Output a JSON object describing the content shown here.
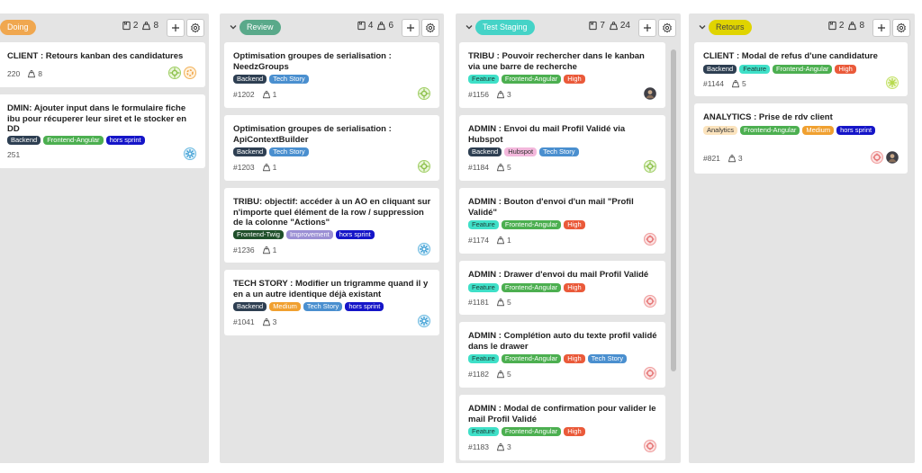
{
  "columns": [
    {
      "name": "Doing",
      "pill_bg": "#f0a74f",
      "pill_fg": "#ffffff",
      "count_tickets": "2",
      "count_points": "8"
    },
    {
      "name": "Review",
      "pill_bg": "#5aa98a",
      "pill_fg": "#ffffff",
      "count_tickets": "4",
      "count_points": "6"
    },
    {
      "name": "Test Staging",
      "pill_bg": "#45d3c7",
      "pill_fg": "#ffffff",
      "count_tickets": "7",
      "count_points": "24"
    },
    {
      "name": "Retours",
      "pill_bg": "#e0d400",
      "pill_fg": "#444444",
      "count_tickets": "2",
      "count_points": "8"
    }
  ],
  "tag_colors": {
    "Backend": {
      "bg": "#2e3f52",
      "fg": "#ffffff"
    },
    "Frontend-Angular": {
      "bg": "#4caf50",
      "fg": "#ffffff"
    },
    "hors sprint": {
      "bg": "#1515c8",
      "fg": "#ffffff"
    },
    "Tech Story": {
      "bg": "#4a8fcf",
      "fg": "#ffffff"
    },
    "Frontend-Twig": {
      "bg": "#1f4f2a",
      "fg": "#ffffff"
    },
    "Improvement": {
      "bg": "#9b8fd4",
      "fg": "#ffffff"
    },
    "Medium": {
      "bg": "#f0a030",
      "fg": "#ffffff"
    },
    "Feature": {
      "bg": "#3fe0c8",
      "fg": "#1d3d38"
    },
    "High": {
      "bg": "#ea5a3a",
      "fg": "#ffffff"
    },
    "Hubspot": {
      "bg": "#f3b8dc",
      "fg": "#333333"
    },
    "Analytics": {
      "bg": "#fbe3bd",
      "fg": "#333333"
    }
  },
  "cards": [
    {
      "col": 0,
      "title": "CLIENT : Retours kanban des candidatures",
      "tags": [],
      "id": "220",
      "points": "8",
      "avatars": [
        "green",
        "orange"
      ]
    },
    {
      "col": 0,
      "title": "DMIN: Ajouter input dans le formulaire fiche ibu pour récuperer leur siret et le stocker en DD",
      "tags": [
        "Backend",
        "Frontend-Angular",
        "hors sprint"
      ],
      "id": "251",
      "points": "",
      "avatars": [
        "blue"
      ]
    },
    {
      "col": 1,
      "title": "Optimisation groupes de serialisation : NeedzGroups",
      "tags": [
        "Backend",
        "Tech Story"
      ],
      "id": "#1202",
      "points": "1",
      "avatars": [
        "green"
      ]
    },
    {
      "col": 1,
      "title": "Optimisation groupes de serialisation : ApiContextBuilder",
      "tags": [
        "Backend",
        "Tech Story"
      ],
      "id": "#1203",
      "points": "1",
      "avatars": [
        "green"
      ]
    },
    {
      "col": 1,
      "title": "TRIBU: objectif: accéder à un AO en cliquant sur n'importe quel élément de la row / suppression de la colonne \"Actions\"",
      "tags": [
        "Frontend-Twig",
        "Improvement",
        "hors sprint"
      ],
      "id": "#1236",
      "points": "1",
      "avatars": [
        "blue"
      ]
    },
    {
      "col": 1,
      "title": "TECH STORY : Modifier un trigramme quand il y en a un autre identique déjà existant",
      "tags": [
        "Backend",
        "Medium",
        "Tech Story",
        "hors sprint"
      ],
      "id": "#1041",
      "points": "3",
      "avatars": [
        "blue"
      ]
    },
    {
      "col": 2,
      "title": "TRIBU : Pouvoir rechercher dans le kanban via une barre de recherche",
      "tags": [
        "Feature",
        "Frontend-Angular",
        "High"
      ],
      "id": "#1156",
      "points": "3",
      "avatars": [
        "photo"
      ]
    },
    {
      "col": 2,
      "title": "ADMIN : Envoi du mail Profil Validé via Hubspot",
      "tags": [
        "Backend",
        "Hubspot",
        "Tech Story"
      ],
      "id": "#1184",
      "points": "5",
      "avatars": [
        "green"
      ]
    },
    {
      "col": 2,
      "title": "ADMIN : Bouton d'envoi d'un mail \"Profil Validé\"",
      "tags": [
        "Feature",
        "Frontend-Angular",
        "High"
      ],
      "id": "#1174",
      "points": "1",
      "avatars": [
        "red"
      ]
    },
    {
      "col": 2,
      "title": "ADMIN : Drawer d'envoi du mail Profil Validé",
      "tags": [
        "Feature",
        "Frontend-Angular",
        "High"
      ],
      "id": "#1181",
      "points": "5",
      "avatars": [
        "red"
      ]
    },
    {
      "col": 2,
      "title": "ADMIN : Complétion auto du texte profil validé dans le drawer",
      "tags": [
        "Feature",
        "Frontend-Angular",
        "High",
        "Tech Story"
      ],
      "id": "#1182",
      "points": "5",
      "avatars": [
        "red"
      ]
    },
    {
      "col": 2,
      "title": "ADMIN : Modal de confirmation pour valider le mail Profil Validé",
      "tags": [
        "Feature",
        "Frontend-Angular",
        "High"
      ],
      "id": "#1183",
      "points": "3",
      "avatars": [
        "red"
      ]
    },
    {
      "col": 3,
      "title": "CLIENT : Modal de refus d'une candidature",
      "tags": [
        "Backend",
        "Feature",
        "Frontend-Angular",
        "High"
      ],
      "id": "#1144",
      "points": "5",
      "avatars": [
        "lime"
      ]
    },
    {
      "col": 3,
      "title": "ANALYTICS : Prise de rdv client",
      "tags": [
        "Analytics",
        "Frontend-Angular",
        "Medium",
        "hors sprint"
      ],
      "id": "#821",
      "points": "3",
      "avatars": [
        "red",
        "photo"
      ]
    }
  ]
}
